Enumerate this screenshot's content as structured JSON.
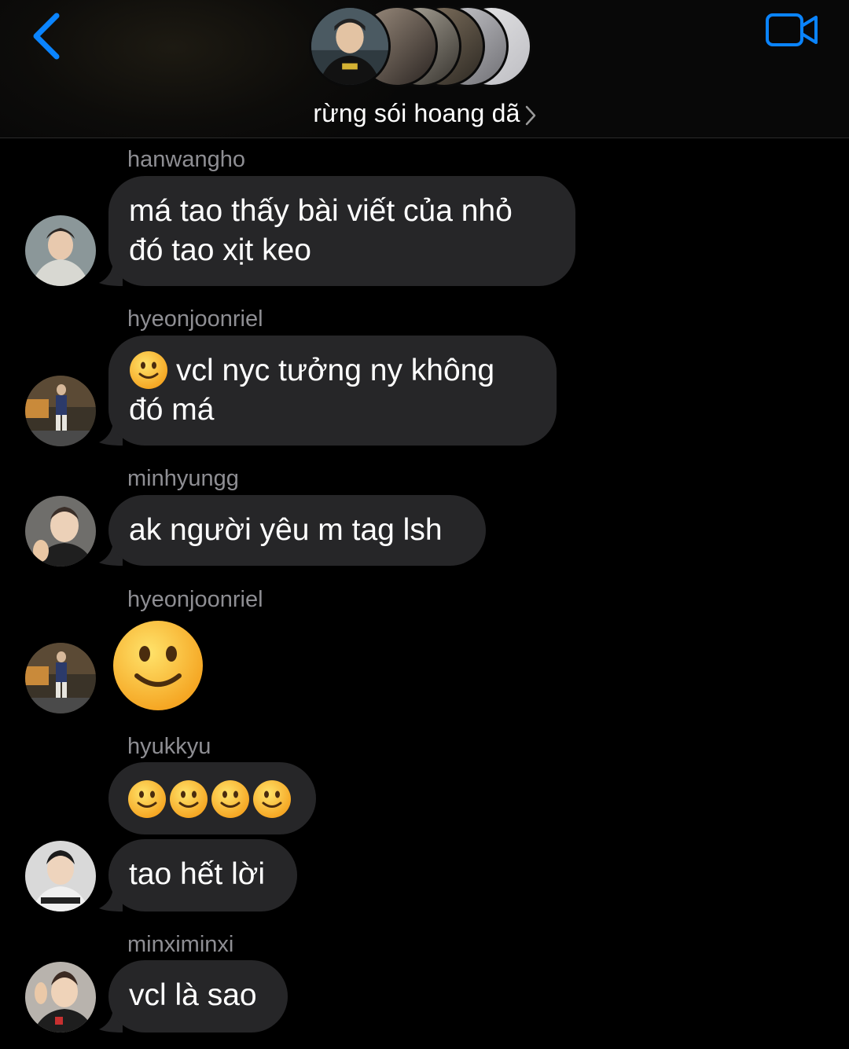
{
  "header": {
    "group_name": "rừng sói hoang dã",
    "back_icon": "chevron-left-icon",
    "video_icon": "video-camera-icon",
    "accent": "#0a84ff"
  },
  "messages": [
    {
      "sender": "hanwangho",
      "lines": [
        "má tao thấy bài viết của nhỏ",
        "đó tao xịt keo"
      ]
    },
    {
      "sender": "hyeonjoonriel",
      "emoji": "slightly-smiling-face",
      "lines": [
        "vcl nyc tưởng ny không",
        "đó má"
      ]
    },
    {
      "sender": "minhyungg",
      "lines": [
        "ak người yêu m tag lsh"
      ]
    },
    {
      "sender": "hyeonjoonriel",
      "emoji": "slightly-smiling-face-large"
    },
    {
      "sender": "hyukkyu",
      "emoji_count": 4,
      "emoji": "slightly-smiling-face"
    },
    {
      "lines": [
        "tao hết lời"
      ]
    },
    {
      "sender": "minximinxi",
      "lines": [
        "vcl là sao"
      ]
    }
  ],
  "colors": {
    "bubble": "#262628",
    "sender": "#8e8e93",
    "background": "#000000"
  }
}
